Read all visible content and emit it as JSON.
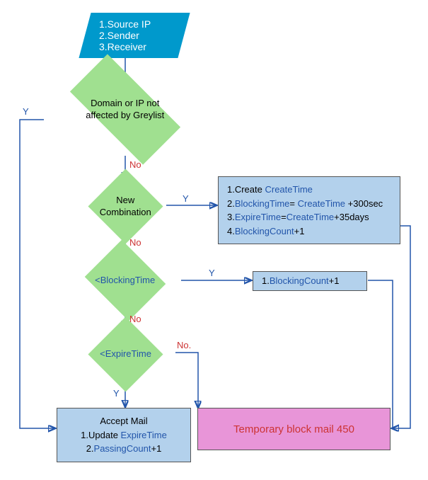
{
  "start": {
    "line1": "1.Source IP",
    "line2": "2.Sender",
    "line3": "3.Receiver"
  },
  "decision1": {
    "text": "Domain or IP not affected by Greylist"
  },
  "decision2": {
    "text": "New Combination"
  },
  "decision3": {
    "text": "<BlockingTime"
  },
  "decision4": {
    "text": "<ExpireTime"
  },
  "process_create": {
    "l1a": "1.Create ",
    "l1b": "CreateTime",
    "l2a": "2.",
    "l2b": "BlockingTime",
    "l2c": "= ",
    "l2d": "CreateTime",
    "l2e": " +300sec",
    "l3a": "3.",
    "l3b": "ExpireTime",
    "l3c": "=",
    "l3d": "CreateTime",
    "l3e": "+35days",
    "l4a": "4.",
    "l4b": "BlockingCount",
    "l4c": "+1"
  },
  "process_blocking": {
    "l1a": "1.",
    "l1b": "BlockingCount",
    "l1c": "+1"
  },
  "process_accept": {
    "title": "Accept Mail",
    "l1a": "1.Update ",
    "l1b": "ExpireTime",
    "l2a": "2.",
    "l2b": "PassingCount",
    "l2c": "+1"
  },
  "process_block": {
    "text": "Temporary block mail 450"
  },
  "labels": {
    "y": "Y",
    "no": "No",
    "no2": "No."
  }
}
